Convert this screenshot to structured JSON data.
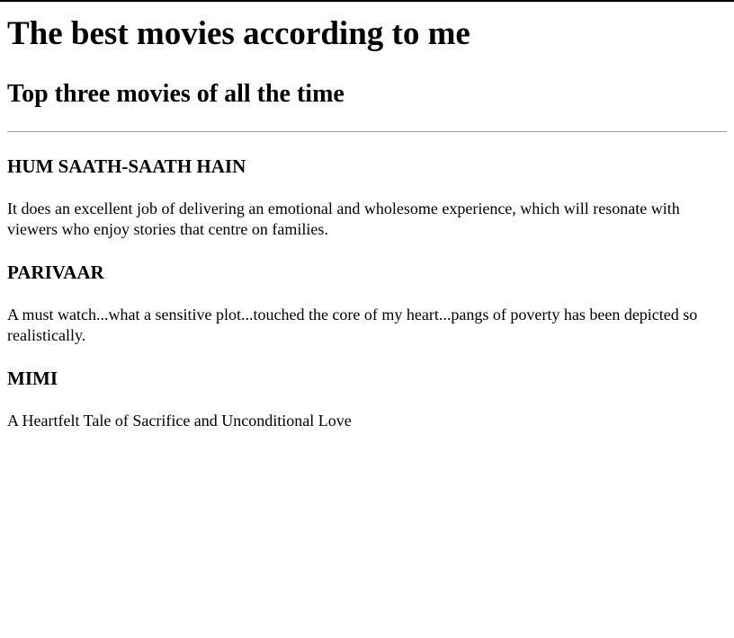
{
  "page": {
    "title": "The best movies according to me",
    "subtitle": "Top three movies of all the time"
  },
  "movies": [
    {
      "name": "HUM SAATH-SAATH HAIN",
      "review": "It does an excellent job of delivering an emotional and wholesome experience, which will resonate with viewers who enjoy stories that centre on families."
    },
    {
      "name": "PARIVAAR",
      "review": "A must watch...what a sensitive plot...touched the core of my heart...pangs of poverty has been depicted so realistically."
    },
    {
      "name": "MIMI",
      "review": "A Heartfelt Tale of Sacrifice and Unconditional Love"
    }
  ]
}
